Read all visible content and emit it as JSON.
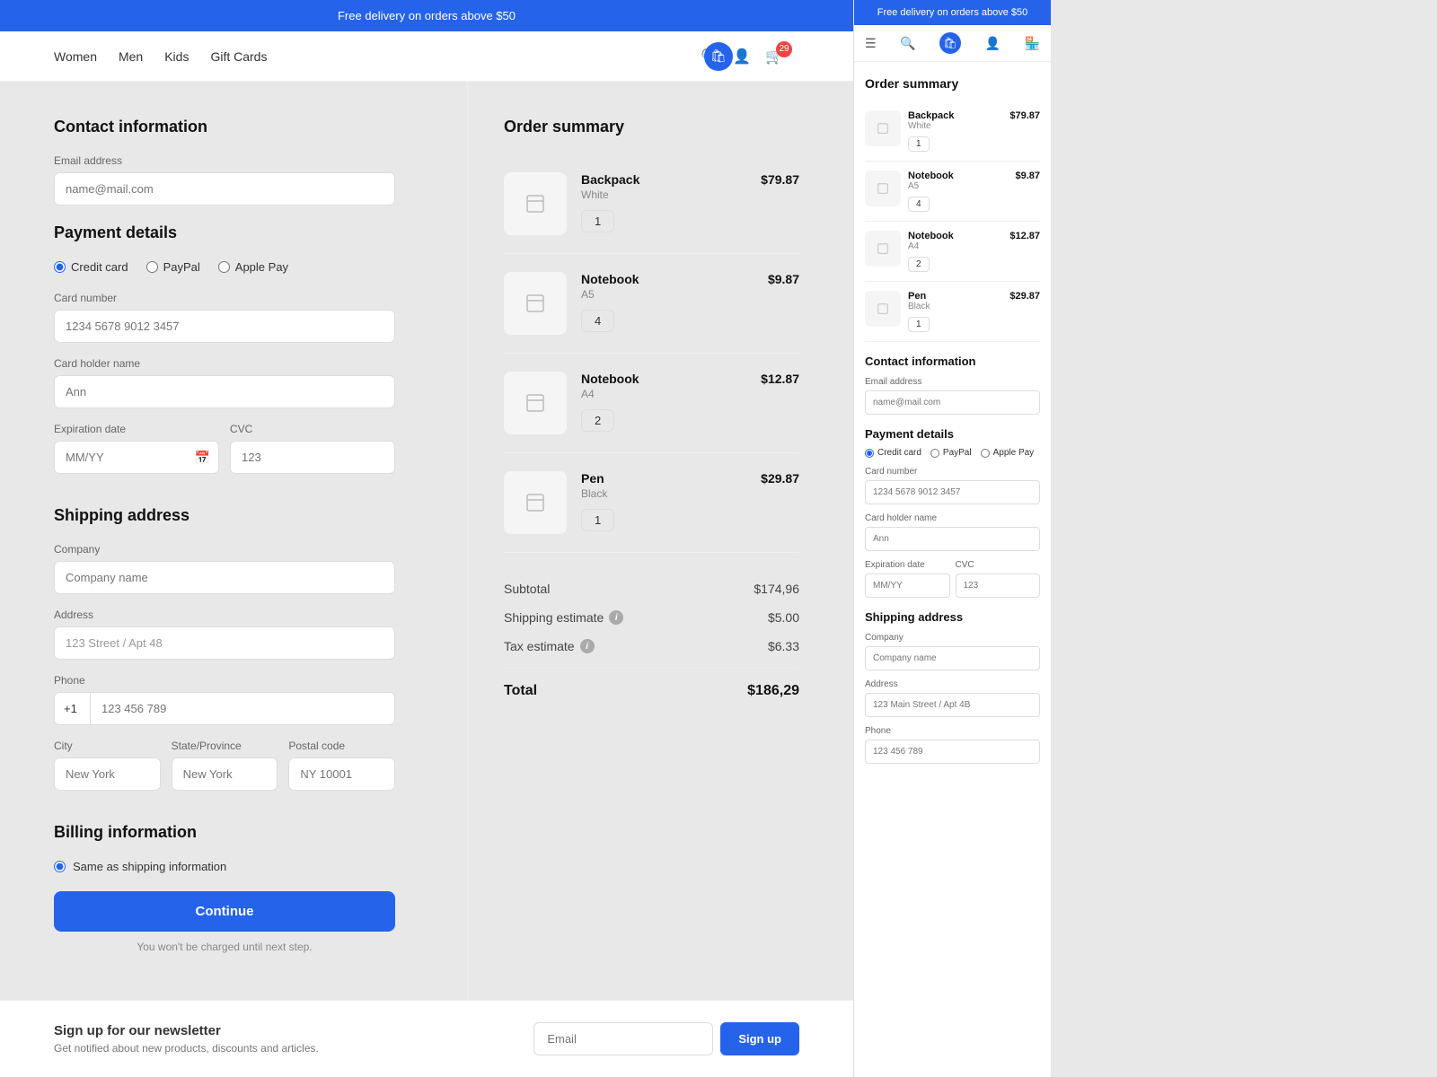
{
  "promo": {
    "text": "Free delivery on orders above $50"
  },
  "nav": {
    "links": [
      "Women",
      "Men",
      "Kids",
      "Gift Cards"
    ],
    "cart_count": "29",
    "icons": [
      "search",
      "user",
      "cart"
    ]
  },
  "contact": {
    "title": "Contact information",
    "email_label": "Email address",
    "email_placeholder": "name@mail.com"
  },
  "payment": {
    "title": "Payment details",
    "options": [
      "Credit card",
      "PayPal",
      "Apple Pay"
    ],
    "card_number_label": "Card number",
    "card_number_placeholder": "1234 5678 9012 3457",
    "card_holder_label": "Card holder name",
    "card_holder_placeholder": "Ann",
    "expiry_label": "Expiration date",
    "expiry_placeholder": "MM/YY",
    "cvc_label": "CVC",
    "cvc_placeholder": "123"
  },
  "shipping": {
    "title": "Shipping address",
    "company_label": "Company",
    "company_placeholder": "Company name",
    "address_label": "Address",
    "address_placeholder": "123 Main Street / Apt 4B",
    "address_value": "123 Street / Apt 48",
    "phone_label": "Phone",
    "phone_prefix": "+1",
    "phone_placeholder": "123 456 789",
    "city_label": "City",
    "city_value": "New York",
    "state_label": "State/Province",
    "state_value": "New York",
    "postal_label": "Postal code",
    "postal_value": "NY 10001"
  },
  "billing": {
    "title": "Billing information",
    "same_shipping_label": "Same as shipping information"
  },
  "actions": {
    "continue_label": "Continue",
    "not_charged": "You won't be charged until next step."
  },
  "order_summary": {
    "title": "Order summary",
    "items": [
      {
        "name": "Backpack",
        "variant": "White",
        "qty": "1",
        "price": "$79.87"
      },
      {
        "name": "Notebook",
        "variant": "A5",
        "qty": "4",
        "price": "$9.87"
      },
      {
        "name": "Notebook",
        "variant": "A4",
        "qty": "2",
        "price": "$12.87"
      },
      {
        "name": "Pen",
        "variant": "Black",
        "qty": "1",
        "price": "$29.87"
      }
    ],
    "subtotal_label": "Subtotal",
    "subtotal_value": "$174,96",
    "shipping_label": "Shipping estimate",
    "shipping_value": "$5.00",
    "tax_label": "Tax estimate",
    "tax_value": "$6.33",
    "total_label": "Total",
    "total_value": "$186,29"
  },
  "footer": {
    "newsletter_title": "Sign up for our newsletter",
    "newsletter_desc": "Get notified about new products, discounts and articles.",
    "email_placeholder": "Email",
    "signup_label": "Sign up"
  },
  "right_panel": {
    "promo_text": "Free delivery on orders above $50",
    "order_summary_title": "Order summary",
    "items": [
      {
        "name": "Backpack",
        "variant": "White",
        "qty": "1",
        "price": "$79.87"
      },
      {
        "name": "Notebook",
        "variant": "A5",
        "qty": "4",
        "price": "$9.87"
      },
      {
        "name": "Notebook",
        "variant": "A4",
        "qty": "2",
        "price": "$12.87"
      },
      {
        "name": "Pen",
        "variant": "Black",
        "qty": "1",
        "price": "$29.87"
      }
    ],
    "contact_title": "Contact information",
    "email_label": "Email address",
    "email_placeholder": "name@mail.com",
    "payment_title": "Payment details",
    "payment_options": [
      "Credit card",
      "PayPal",
      "Apple Pay"
    ],
    "card_number_label": "Card number",
    "card_number_placeholder": "1234 5678 9012 3457",
    "card_holder_label": "Card holder name",
    "card_holder_placeholder": "Ann",
    "expiry_label": "Expiration date",
    "expiry_placeholder": "MM/YY",
    "cvc_label": "CVC",
    "cvc_placeholder": "123",
    "shipping_title": "Shipping address",
    "company_label": "Company",
    "company_placeholder": "Company name",
    "address_label": "Address",
    "address_placeholder": "123 Main Street / Apt 4B",
    "phone_label": "Phone"
  }
}
